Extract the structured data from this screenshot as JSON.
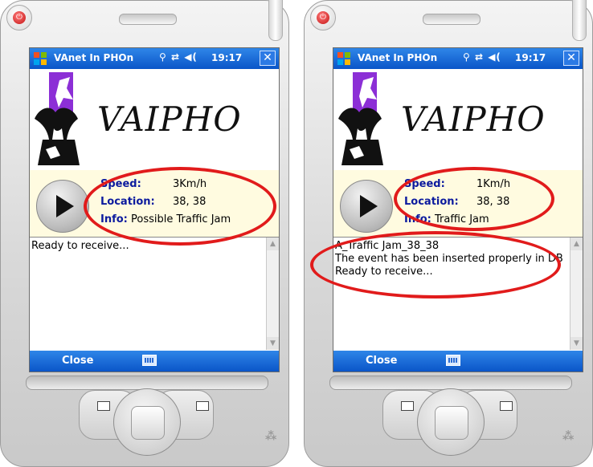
{
  "phones": [
    {
      "id": "left",
      "window_title": "VAnet In PHOn",
      "status_icons": "⚲ ⇄ ◀(",
      "time": "19:17",
      "close_x": "✕",
      "brand": "VAIPHO",
      "speed_label": "Speed:",
      "speed_value": "3Km/h",
      "location_label": "Location:",
      "location_value": "38, 38",
      "info_label": "Info:",
      "info_value": "Possible Traffic Jam",
      "log_text": "Ready to receive...",
      "menu_close": "Close"
    },
    {
      "id": "right",
      "window_title": "VAnet In PHOn",
      "status_icons": "⚲ ⇄ ◀(",
      "time": "19:17",
      "close_x": "✕",
      "brand": "VAIPHO",
      "speed_label": "Speed:",
      "speed_value": "1Km/h",
      "location_label": "Location:",
      "location_value": "38, 38",
      "info_label": "Info:",
      "info_value": "Traffic Jam",
      "log_text": "A_Traffic Jam_38_38\nThe event has been inserted properly in DB\nReady to receive...",
      "menu_close": "Close"
    }
  ],
  "colors": {
    "titlebar": "#0a55c8",
    "label": "#0b1a9e",
    "info_bg": "#fffbe0",
    "highlight_ellipse": "#e11b1b"
  },
  "icons": [
    "power-icon",
    "windows-start-icon",
    "antenna-icon",
    "sync-icon",
    "volume-icon",
    "keyboard-icon",
    "play-icon",
    "goat-logo"
  ]
}
